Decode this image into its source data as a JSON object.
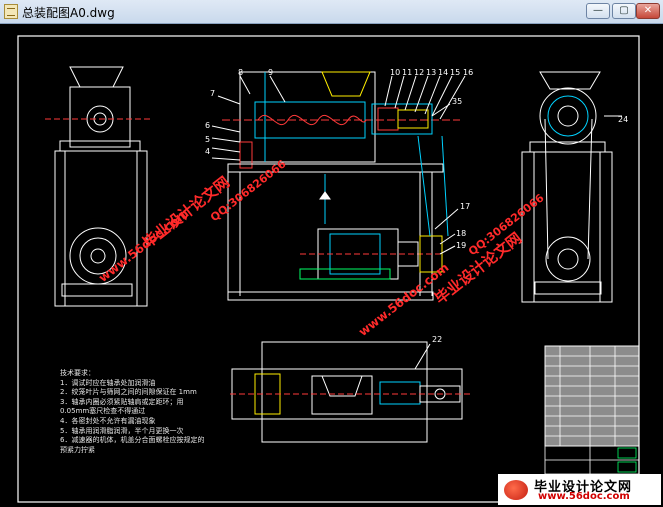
{
  "window": {
    "title": "总装配图A0.dwg",
    "min_glyph": "—",
    "max_glyph": "▢",
    "close_glyph": "✕"
  },
  "drawing": {
    "part_labels": [
      "8",
      "9",
      "10",
      "11",
      "12",
      "13",
      "14",
      "15",
      "16",
      "7",
      "6",
      "5",
      "4",
      "35",
      "17",
      "18",
      "19",
      "22",
      "24"
    ],
    "tech_requirements": [
      "技术要求：",
      "1．调试时应在轴承处加润滑油",
      "2．绞笼叶片与筛网之间的间隙保证在 1mm",
      "3．轴承内圈必须紧贴轴肩或定距环；用",
      "0.05mm塞尺检查不得通过",
      "4．各密封处不允许有漏油现象",
      "5．轴承用润滑脂润滑，半个月更换一次",
      "6．减速器的机体，机盖分合面螺栓应按规定的",
      "预紧力拧紧"
    ]
  },
  "watermarks": {
    "site_a": "毕业设计论文网",
    "url_a": "www.56doc.com",
    "qq": "QQ:306826066"
  },
  "footer": {
    "name": "毕业设计论文网",
    "url": "www.56doc.com"
  },
  "colors": {
    "frame": "#ffffff",
    "part_line": "#ffffff",
    "dimension": "#00d2ff",
    "highlight": "#ff3a3a",
    "detail": "#ffee00",
    "hatch": "#00ff66",
    "watermark": "#ff2a2a"
  }
}
